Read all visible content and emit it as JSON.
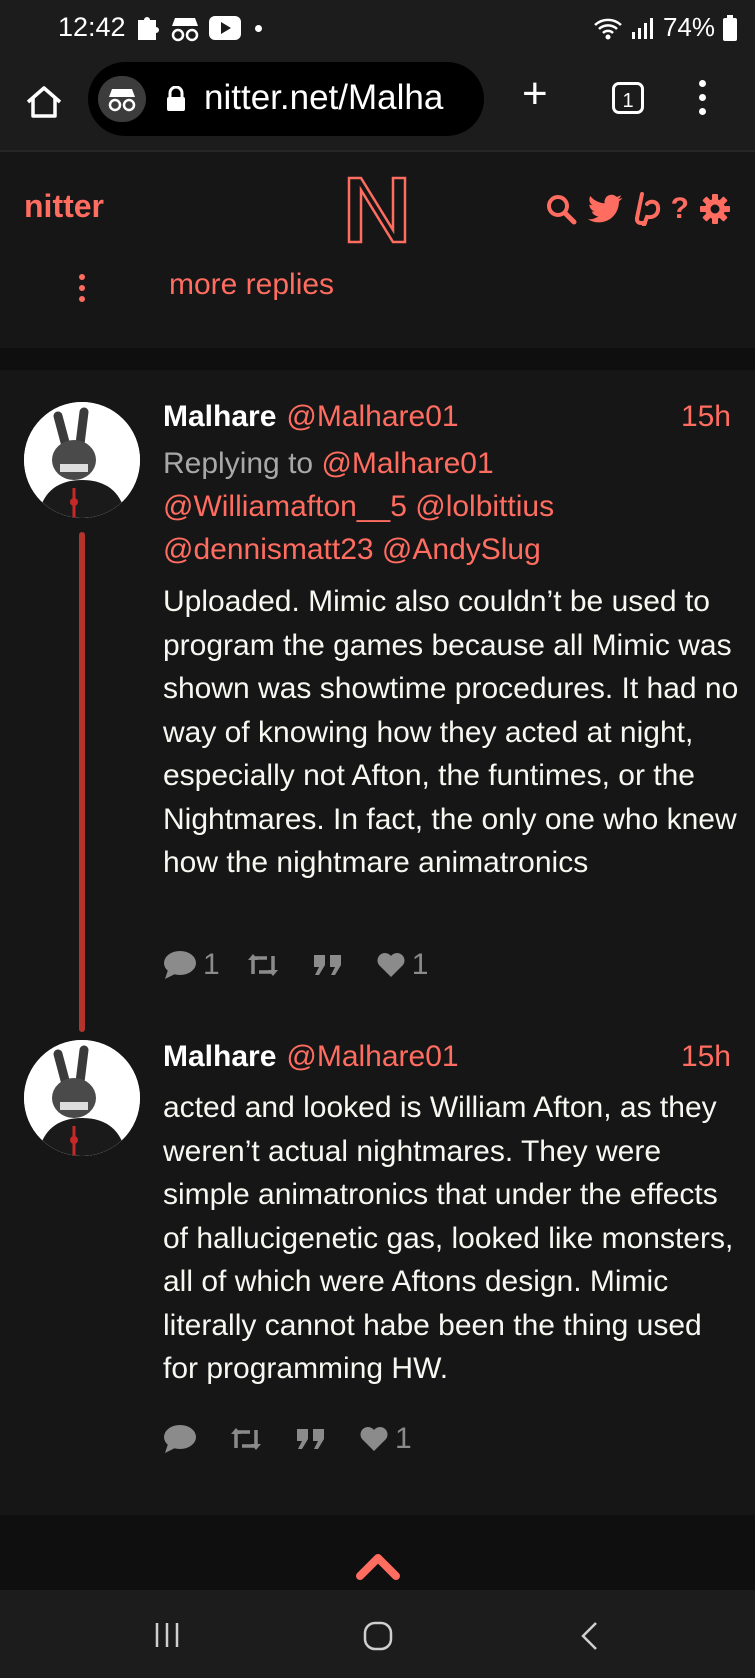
{
  "status_bar": {
    "time": "12:42",
    "battery": "74%",
    "icons": [
      "puzzle-icon",
      "incognito-icon",
      "youtube-icon",
      "wifi-icon",
      "signal-icon",
      "battery-icon"
    ]
  },
  "browser": {
    "url": "nitter.net/Malha",
    "tab_count": "1"
  },
  "nav": {
    "brand": "nitter",
    "icons": [
      "search-icon",
      "twitter-icon",
      "liberapay-icon",
      "help-icon",
      "settings-icon"
    ],
    "help_label": "?"
  },
  "more_replies": "more replies",
  "colors": {
    "accent": "#ff6c60",
    "background": "#0f0f0f",
    "panel": "#161616"
  },
  "tweets": [
    {
      "fullname": "Malhare",
      "handle": "@Malhare01",
      "time": "15h",
      "replying_label": "Replying to",
      "replying_to": [
        "@Malhare01",
        "@Williamafton__5",
        "@lolbittius",
        "@dennismatt23",
        "@AndySlug"
      ],
      "body": "Uploaded. Mimic also couldn’t be used to program the games because all Mimic was shown was showtime procedures. It had no way of knowing how they acted at night, especially not Afton, the funtimes, or the Nightmares. In fact, the only one who knew how the nightmare animatronics",
      "stats": {
        "replies": "1",
        "retweets": "",
        "quotes": "",
        "likes": "1"
      }
    },
    {
      "fullname": "Malhare",
      "handle": "@Malhare01",
      "time": "15h",
      "body": "acted and looked is William Afton, as they weren’t actual nightmares. They were simple animatronics that under the effects of hallucigenetic gas, looked like monsters, all of which were Aftons design. Mimic literally cannot habe been the thing used for programming HW.",
      "stats": {
        "replies": "",
        "retweets": "",
        "quotes": "",
        "likes": "1"
      }
    }
  ]
}
